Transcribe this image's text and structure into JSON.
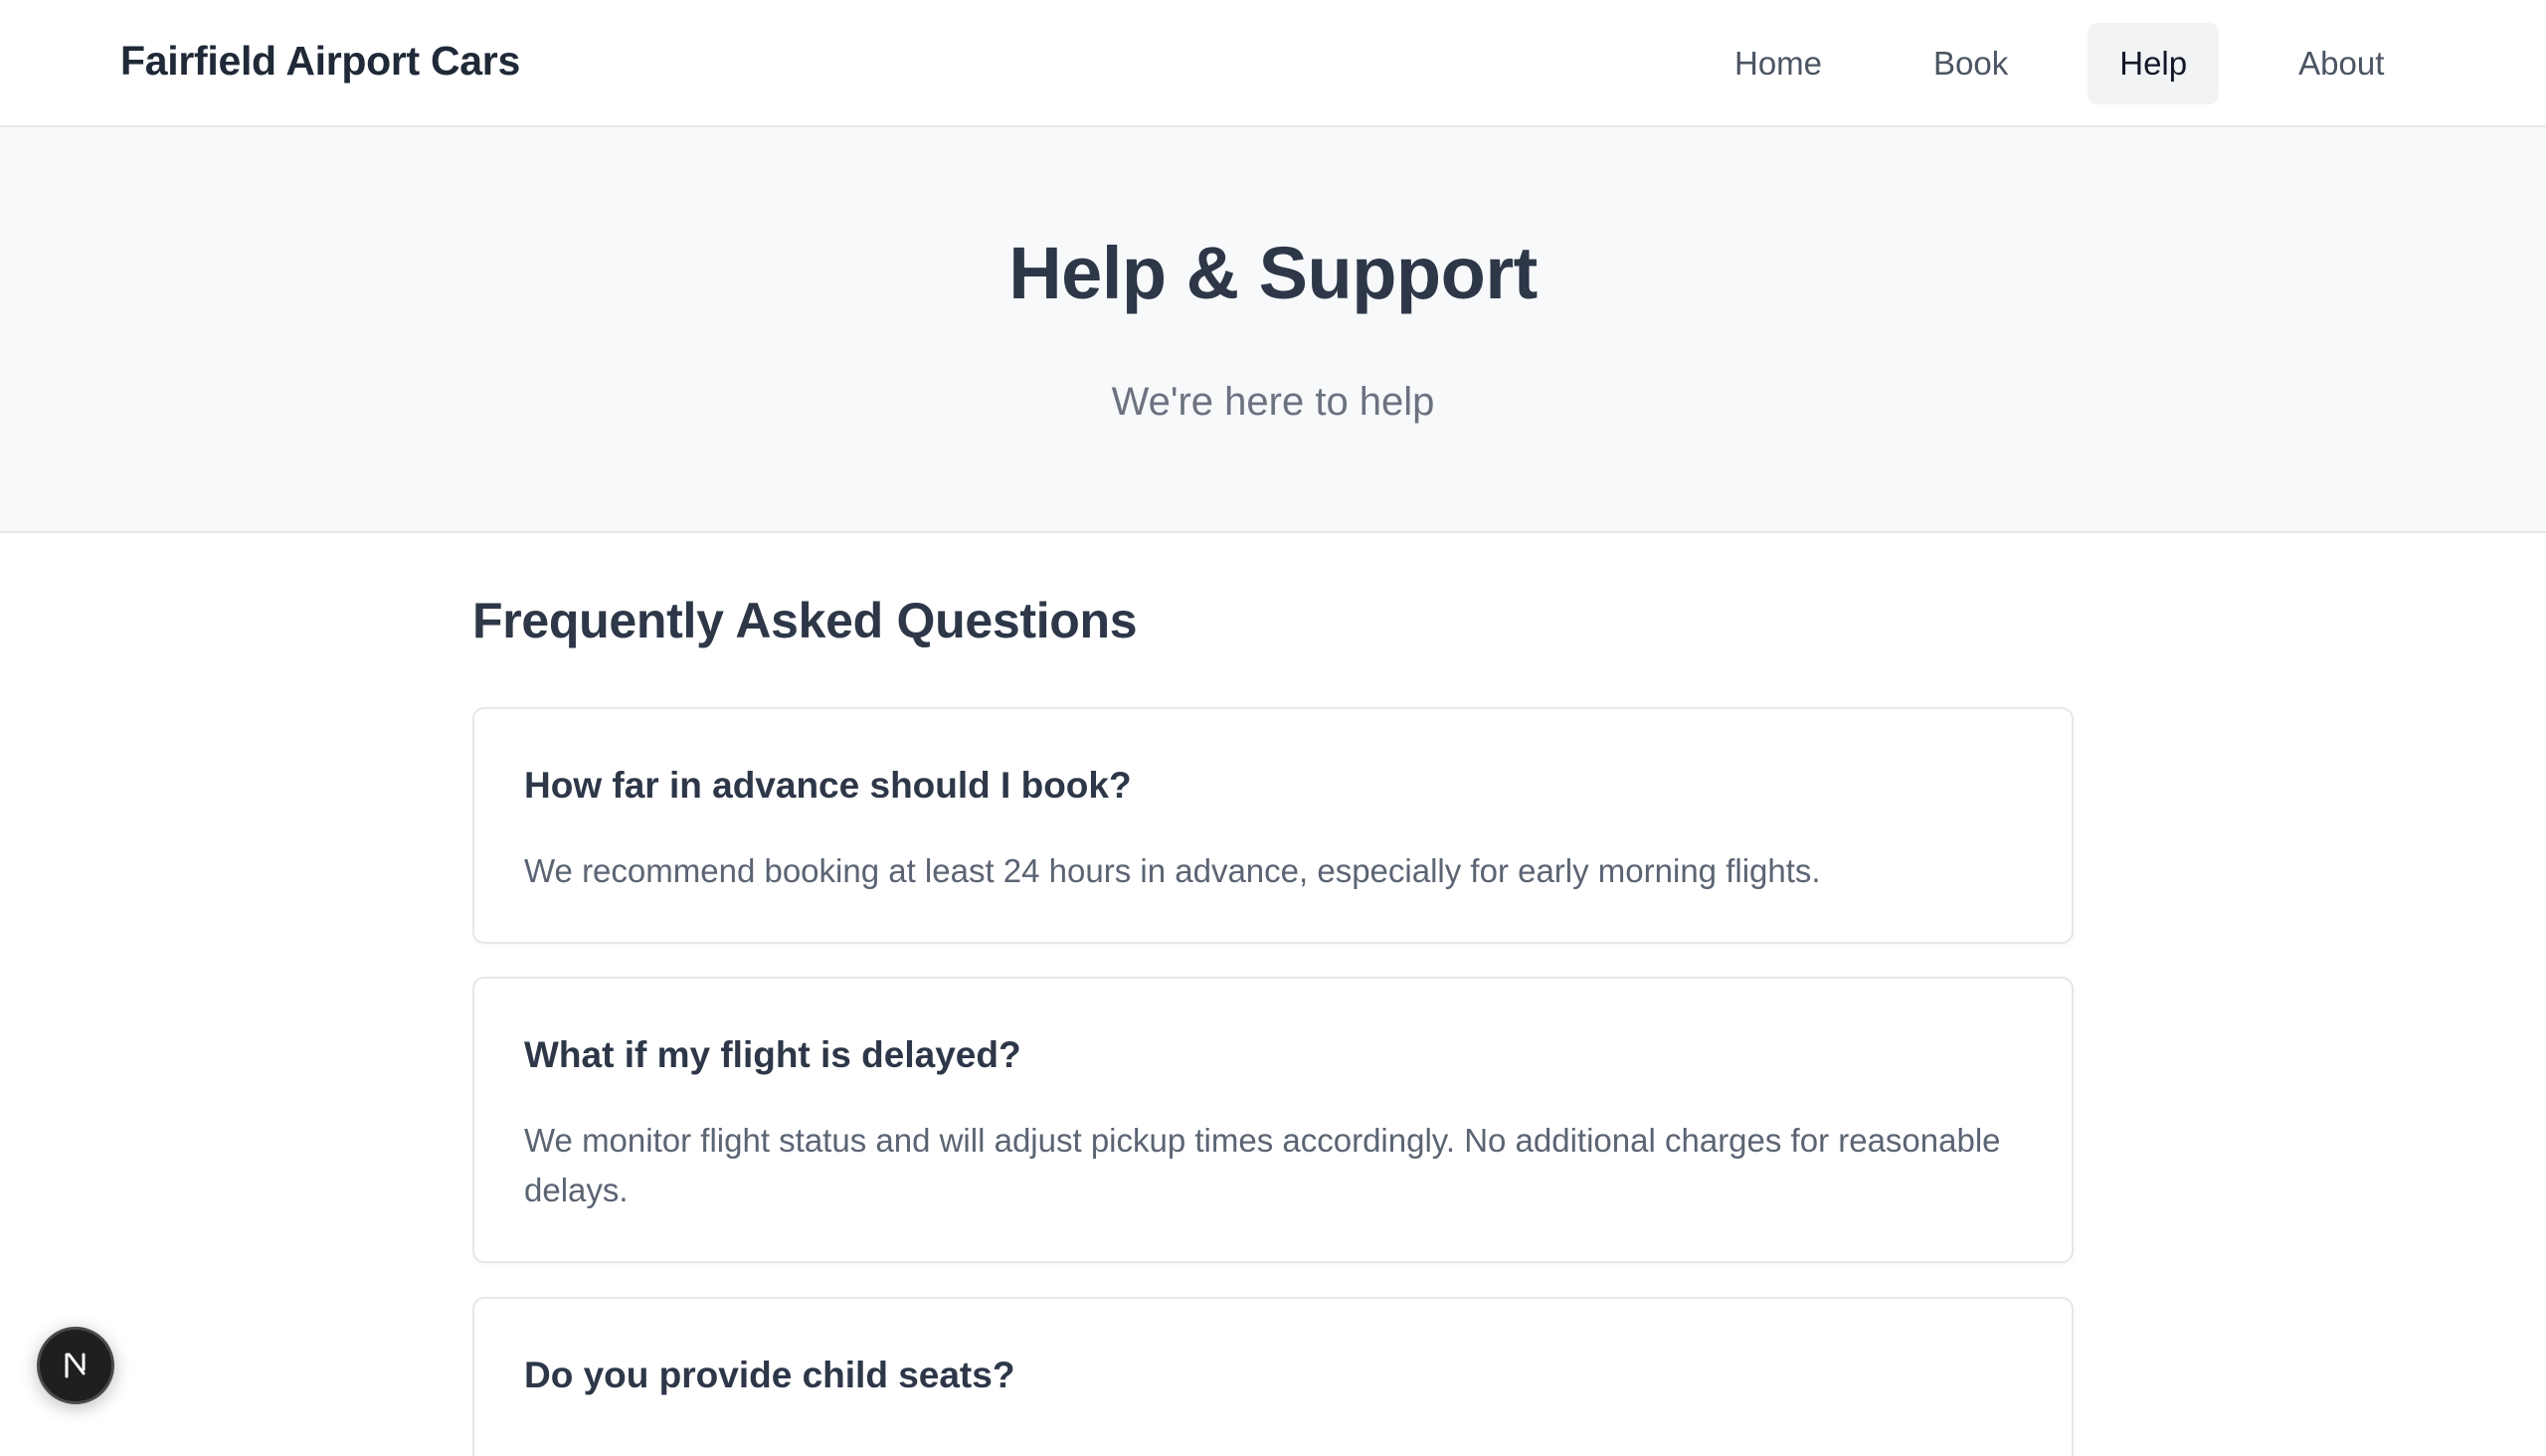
{
  "header": {
    "brand": "Fairfield Airport Cars",
    "nav": [
      {
        "label": "Home",
        "active": false
      },
      {
        "label": "Book",
        "active": false
      },
      {
        "label": "Help",
        "active": true
      },
      {
        "label": "About",
        "active": false
      }
    ]
  },
  "hero": {
    "title": "Help & Support",
    "subtitle": "We're here to help"
  },
  "faq": {
    "heading": "Frequently Asked Questions",
    "items": [
      {
        "question": "How far in advance should I book?",
        "answer": "We recommend booking at least 24 hours in advance, especially for early morning flights."
      },
      {
        "question": "What if my flight is delayed?",
        "answer": "We monitor flight status and will adjust pickup times accordingly. No additional charges for reasonable delays."
      },
      {
        "question": "Do you provide child seats?",
        "answer": ""
      }
    ]
  },
  "dev_badge": {
    "icon": "nextjs-logo-icon",
    "letter": "N"
  },
  "colors": {
    "text_primary": "#2d3748",
    "text_muted": "#6b7280",
    "hero_bg": "#f8f9fb",
    "nav_active_bg": "#f1f3f5",
    "border": "#e5e7eb"
  }
}
